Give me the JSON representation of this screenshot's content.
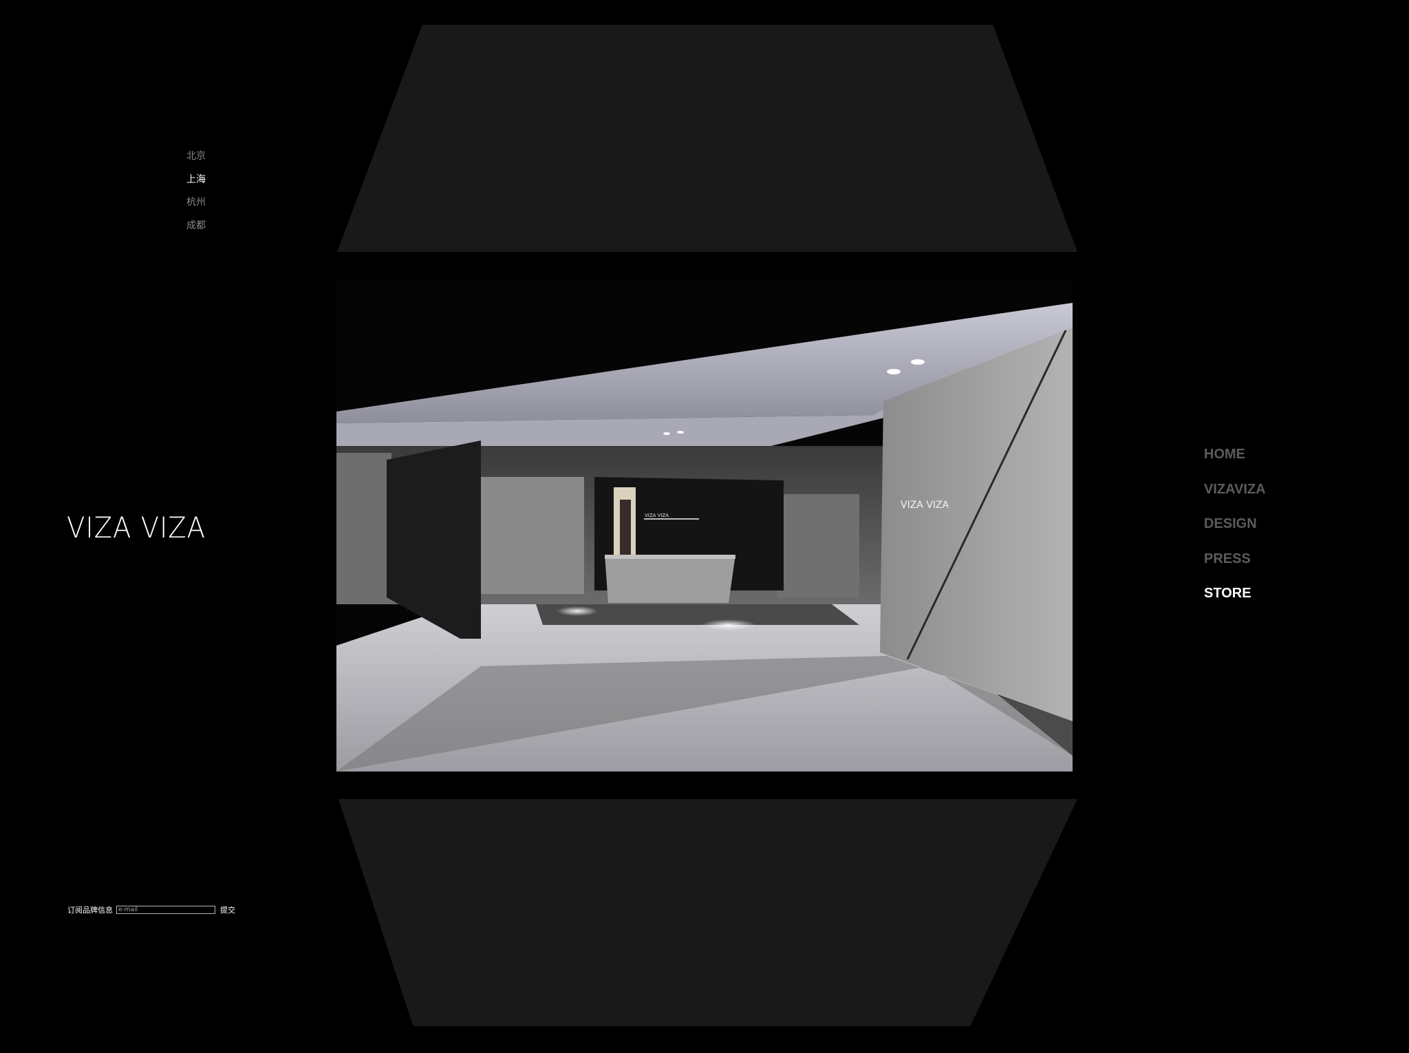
{
  "cities": [
    {
      "label": "北京",
      "active": false
    },
    {
      "label": "上海",
      "active": true
    },
    {
      "label": "杭州",
      "active": false
    },
    {
      "label": "成都",
      "active": false
    }
  ],
  "logo": {
    "text": "VIZA VIZA"
  },
  "hero": {
    "wall_sign": "VIZA VIZA",
    "counter_sign": "VIZA VIZA"
  },
  "nav": [
    {
      "label": "HOME",
      "active": false
    },
    {
      "label": "VIZAVIZA",
      "active": false
    },
    {
      "label": "DESIGN",
      "active": false
    },
    {
      "label": "PRESS",
      "active": false
    },
    {
      "label": "STORE",
      "active": true
    }
  ],
  "subscribe": {
    "label": "订阅品牌信息",
    "placeholder": "e-mail",
    "submit_label": "提交"
  },
  "colors": {
    "background": "#000000",
    "panel": "#191919",
    "nav_inactive": "#5c5c5c",
    "nav_active": "#ffffff",
    "city_inactive": "#8a8a8a",
    "city_active": "#ffffff"
  }
}
